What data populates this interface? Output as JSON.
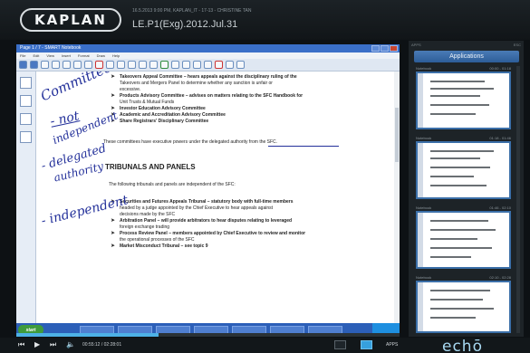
{
  "header": {
    "logo_text": "KAPLAN",
    "meta_small": "16.5.2013 9:00 PM, KAPLAN_IT - 17-13 - CHRISTINE TAN",
    "lecture_title": "LE.P1(Exg).2012.Jul.31"
  },
  "app": {
    "window_title": "Page 1 / 7 - SMART Notebook",
    "menu": [
      "File",
      "Edit",
      "View",
      "Insert",
      "Format",
      "Draw",
      "Help"
    ]
  },
  "document": {
    "committees": [
      "Takeovers Appeal Committee – hears appeals against the disciplinary ruling of the",
      "Takeovers and Mergers Panel to determine whether any sanction is unfair or",
      "excessive.",
      "Products Advisory Committee – advises on matters relating to the SFC Handbook for",
      "Unit Trusts & Mutual Funds",
      "Investor Education Advisory Committee",
      "Academic and Accreditation Advisory Committee",
      "Share Registrars' Disciplinary Committee"
    ],
    "summary_line": "These committees have executive powers under the delegated authority from the SFC.",
    "section_heading": "TRIBUNALS AND PANELS",
    "section_intro": "The following tribunals and panels are independent of the SFC:",
    "tribunals": [
      "Securities and Futures Appeals Tribunal – statutory body with full-time members",
      "headed by a judge appointed by the Chief Executive to hear appeals against",
      "decisions made by the SFC",
      "Arbitration Panel – will provide arbitrators to hear disputes relating to leveraged",
      "foreign exchange trading",
      "Process Review Panel – members appointed by Chief Executive to review and monitor",
      "the operational processes of the SFC",
      "Market Misconduct Tribunal – see topic 9"
    ]
  },
  "handwriting": {
    "word1": "Committees",
    "word2": "- not",
    "word3": "independent",
    "word4": "- delegated",
    "word5": "authority",
    "word6": "- independent"
  },
  "taskbar": {
    "start_label": "start"
  },
  "panel": {
    "header_left": "APPS",
    "header_right": "ESC",
    "tab_label": "Applications",
    "thumb_labels": [
      {
        "left": "Notebook",
        "right": "00:00 - 01:18"
      },
      {
        "left": "Notebook",
        "right": "01:18 - 01:46"
      },
      {
        "left": "Notebook",
        "right": "01:46 - 02:10"
      },
      {
        "left": "Notebook",
        "right": "02:10 - 02:28"
      }
    ]
  },
  "player": {
    "time": "00:55:12 / 02:28:01",
    "progress_percent": 37,
    "apps_label": "APPS",
    "brand": "echō"
  }
}
